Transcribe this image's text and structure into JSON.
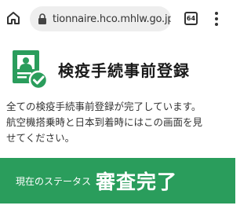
{
  "browser": {
    "url": "tionnaire.hco.mhlw.go.jp",
    "tab_count": "64",
    "icons": {
      "home": "home-icon",
      "lock": "lock-icon",
      "tabs": "tab-switcher-icon",
      "menu": "more-vert-icon"
    }
  },
  "header": {
    "icon": "registration-document-check-icon",
    "title": "検疫手続事前登録"
  },
  "message": {
    "line1": "全ての検疫手続事前登録が完了しています。",
    "line2": "航空機搭乗時と日本到着時にはこの画面を見",
    "line3": "せてください。"
  },
  "status": {
    "label": "現在のステータス",
    "value": "審査完了"
  },
  "colors": {
    "accent_green": "#2a9d5c",
    "url_bar_bg": "#eeeeee",
    "text": "#333333"
  }
}
